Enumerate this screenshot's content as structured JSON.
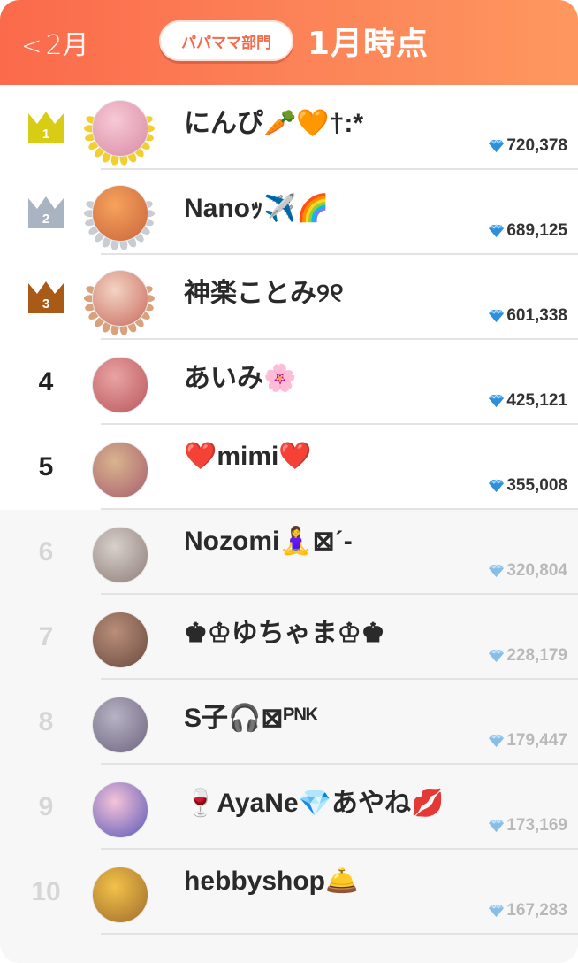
{
  "header": {
    "back_label": "2月",
    "back_chevron": "<",
    "department_label": "パパママ部門",
    "title": "1月時点"
  },
  "colors": {
    "header_start": "#fb6a4b",
    "header_end": "#fe975f",
    "gold": "#d8cd14",
    "silver": "#a9b3c2",
    "bronze": "#a85a16",
    "gem": "#4aa8ee"
  },
  "ranking": [
    {
      "rank": "1",
      "name": "にんぴ🥕🧡†:*",
      "score": "720,378",
      "medal": "gold",
      "avatar_bg": [
        "#f7c9d6",
        "#d88aa4"
      ]
    },
    {
      "rank": "2",
      "name": "Nanoｯ✈️🌈",
      "score": "689,125",
      "medal": "silver",
      "avatar_bg": [
        "#f6a25c",
        "#c9653c"
      ]
    },
    {
      "rank": "3",
      "name": "神楽ことみ୨୧",
      "score": "601,338",
      "medal": "bronze",
      "avatar_bg": [
        "#f3d3c4",
        "#c96b5d"
      ]
    },
    {
      "rank": "4",
      "name": "あいみ🌸",
      "score": "425,121",
      "medal": "",
      "avatar_bg": [
        "#e9a3a3",
        "#b9575d"
      ]
    },
    {
      "rank": "5",
      "name": "❤️mimi❤️",
      "score": "355,008",
      "medal": "",
      "avatar_bg": [
        "#d9b48f",
        "#a85e6d"
      ]
    },
    {
      "rank": "6",
      "name": "Nozomi🧘‍♀️⊠ˊ-",
      "score": "320,804",
      "medal": "",
      "avatar_bg": [
        "#d8d0cb",
        "#8e7d78"
      ]
    },
    {
      "rank": "7",
      "name": "♚♔ゆちゃま♔♚",
      "score": "228,179",
      "medal": "",
      "avatar_bg": [
        "#b98e7a",
        "#6b4a3f"
      ]
    },
    {
      "rank": "8",
      "name": "S子🎧⊠ᴾᴺᴷ",
      "score": "179,447",
      "medal": "",
      "avatar_bg": [
        "#b7b3c4",
        "#6d6480"
      ]
    },
    {
      "rank": "9",
      "name": "🍷AyaNe💎あやね💋",
      "score": "173,169",
      "medal": "",
      "avatar_bg": [
        "#f5c3d8",
        "#5a57b8"
      ]
    },
    {
      "rank": "10",
      "name": "hebbyshop🛎️",
      "score": "167,283",
      "medal": "",
      "avatar_bg": [
        "#f2c24a",
        "#9e6b2b"
      ]
    }
  ]
}
